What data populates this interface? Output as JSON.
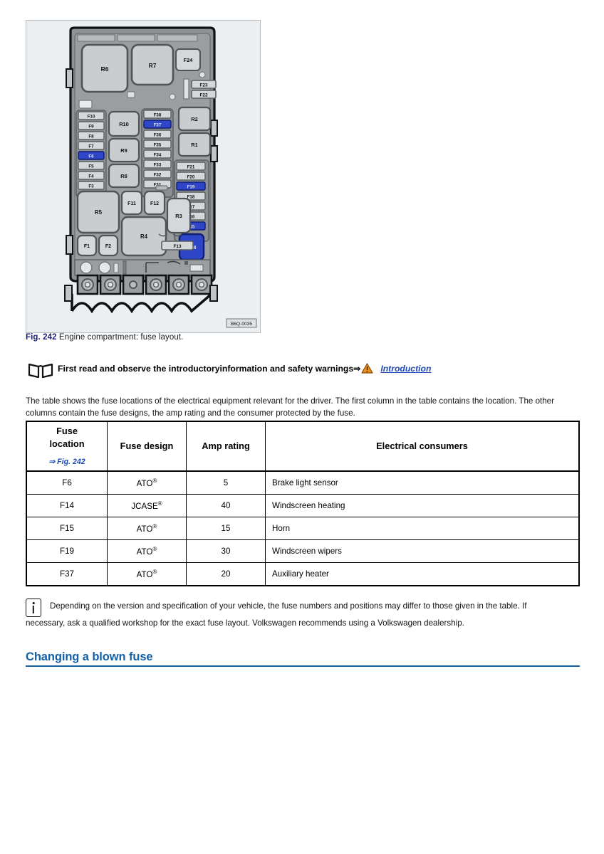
{
  "figure": {
    "caption_number": "Fig. 242",
    "caption_text": "Engine compartment: fuse layout.",
    "image_code": "B6Q-0035",
    "alt_label": "engine-compartment-fuse-layout-diagram",
    "relays": [
      {
        "label": "R6"
      },
      {
        "label": "R7"
      },
      {
        "label": "R10"
      },
      {
        "label": "R9"
      },
      {
        "label": "R8"
      },
      {
        "label": "R5"
      },
      {
        "label": "R4"
      },
      {
        "label": "R3"
      },
      {
        "label": "R2"
      },
      {
        "label": "R1"
      }
    ],
    "fuses_left_column": [
      "F10",
      "F9",
      "F8",
      "F7",
      "F6",
      "F5",
      "F4",
      "F3"
    ],
    "fuses_middle_column": [
      "F38",
      "F37",
      "F36",
      "F35",
      "F34",
      "F33",
      "F32",
      "F31"
    ],
    "fuses_right_column": [
      "F21",
      "F20",
      "F19",
      "F18",
      "F17",
      "F16",
      "F15"
    ],
    "fuses_top_right": [
      "F23",
      "F22"
    ],
    "fuses_other": [
      "F24",
      "F11",
      "F12",
      "F13",
      "F14",
      "F1",
      "F2"
    ],
    "highlighted_fuses": [
      "F6",
      "F37",
      "F19",
      "F15",
      "F14"
    ],
    "colors": {
      "panel_background": "#eceff1",
      "housing_fill": "#8e9294",
      "block_fill": "#c9cdd0",
      "fuse_fill": "#d5d8da",
      "highlight_fill": "#2f46c8",
      "outline": "#1a1a1a"
    }
  },
  "read_first": {
    "text": "First read and observe the introductoryinformation and safety warnings",
    "arrow": "⇒",
    "warning_icon": "warning-triangle-icon",
    "book_icon": "open-book-icon",
    "xref": "Introduction"
  },
  "intro_paragraph": "The table shows the fuse locations of the electrical equipment relevant for the driver. The first column in the table contains the location. The other columns contain the fuse designs, the amp rating and the consumer protected by the fuse.",
  "table": {
    "headers": {
      "fuse_location": "Fuse location",
      "fuse_location_line1": "Fuse",
      "fuse_location_line2": "location",
      "fuse_location_ref": "⇒ Fig. 242",
      "fuse_design": "Fuse design",
      "amp_rating": "Amp rating",
      "electrical_consumers": "Electrical consumers"
    },
    "rows": [
      {
        "location": "F6",
        "design": "ATO",
        "design_mark": "®",
        "amp": "5",
        "consumer": "Brake light sensor"
      },
      {
        "location": "F14",
        "design": "JCASE",
        "design_mark": "®",
        "amp": "40",
        "consumer": "Windscreen heating"
      },
      {
        "location": "F15",
        "design": "ATO",
        "design_mark": "®",
        "amp": "15",
        "consumer": "Horn"
      },
      {
        "location": "F19",
        "design": "ATO",
        "design_mark": "®",
        "amp": "30",
        "consumer": "Windscreen wipers"
      },
      {
        "location": "F37",
        "design": "ATO",
        "design_mark": "®",
        "amp": "20",
        "consumer": "Auxiliary heater"
      }
    ]
  },
  "info_note": {
    "icon": "information-icon",
    "line1": "Depending on the version and specification of your vehicle, the fuse numbers and positions may differ to those given in the table. If",
    "line2": "necessary, ask a qualified workshop for the exact fuse layout. Volkswagen recommends using a Volkswagen dealership."
  },
  "section_heading": {
    "title": "Changing a blown fuse",
    "color": "#1461a8"
  }
}
